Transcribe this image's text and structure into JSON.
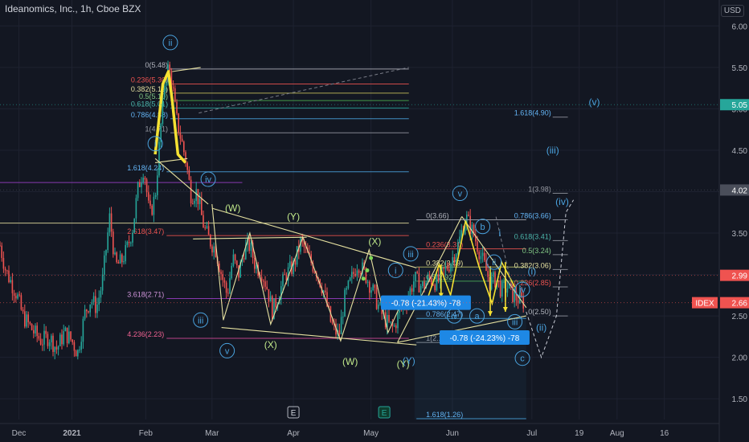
{
  "header": {
    "title": "Ideanomics, Inc., 1h, Cboe BZX",
    "currency": "USD"
  },
  "colors": {
    "bg": "#131722",
    "grid": "#1e2230",
    "up": "#26a69a",
    "down": "#ef5350",
    "wave": "#c0e88a",
    "fib": "#e6e1a0",
    "yellow": "#f5e133",
    "blue": "#4aa3df",
    "pink": "#d64a9a",
    "purple": "#9c3fc8",
    "olive": "#c8c25a"
  },
  "chart_data": {
    "type": "candlestick",
    "symbol": "IDEX",
    "interval": "1h",
    "ylim": [
      1.25,
      6.1
    ],
    "y_ticks": [
      1.5,
      2.0,
      2.5,
      3.0,
      3.5,
      4.0,
      4.5,
      5.0,
      5.5,
      6.0
    ],
    "y_tick_labels": [
      "1.50",
      "2.00",
      "2.50",
      "3.00",
      "3.50",
      "4.00",
      "4.50",
      "5.00",
      "5.50",
      "6.00"
    ],
    "x_ticks": [
      {
        "label": "Dec",
        "t": 0.0
      },
      {
        "label": "2021",
        "t": 2.8
      },
      {
        "label": "Feb",
        "t": 6.7
      },
      {
        "label": "Mar",
        "t": 10.2
      },
      {
        "label": "Apr",
        "t": 14.5
      },
      {
        "label": "May",
        "t": 18.6
      },
      {
        "label": "Jun",
        "t": 22.9
      },
      {
        "label": "Jul",
        "t": 27.1
      },
      {
        "label": "19",
        "t": 29.6
      },
      {
        "label": "Aug",
        "t": 31.6
      },
      {
        "label": "16",
        "t": 34.1
      }
    ],
    "xlim": [
      -1.0,
      37.0
    ],
    "price_path": [
      [
        -1.0,
        3.35
      ],
      [
        -0.7,
        3.05
      ],
      [
        -0.4,
        2.9
      ],
      [
        -0.1,
        2.75
      ],
      [
        0.2,
        2.5
      ],
      [
        0.5,
        2.4
      ],
      [
        0.8,
        2.3
      ],
      [
        1.2,
        2.2
      ],
      [
        1.6,
        2.25
      ],
      [
        2.0,
        2.1
      ],
      [
        2.4,
        2.3
      ],
      [
        2.8,
        2.2
      ],
      [
        3.1,
        2.05
      ],
      [
        3.5,
        2.55
      ],
      [
        3.8,
        2.7
      ],
      [
        4.1,
        2.6
      ],
      [
        4.4,
        2.9
      ],
      [
        4.6,
        3.3
      ],
      [
        4.8,
        3.7
      ],
      [
        5.1,
        3.1
      ],
      [
        5.4,
        3.15
      ],
      [
        5.7,
        3.3
      ],
      [
        6.0,
        3.55
      ],
      [
        6.3,
        4.05
      ],
      [
        6.6,
        4.3
      ],
      [
        6.9,
        3.7
      ],
      [
        7.2,
        3.95
      ],
      [
        7.5,
        4.8
      ],
      [
        7.7,
        5.35
      ],
      [
        7.9,
        5.5
      ],
      [
        8.1,
        5.3
      ],
      [
        8.3,
        4.9
      ],
      [
        8.5,
        4.7
      ],
      [
        8.8,
        4.4
      ],
      [
        9.1,
        3.95
      ],
      [
        9.4,
        4.0
      ],
      [
        9.6,
        3.75
      ],
      [
        9.8,
        3.55
      ],
      [
        10.1,
        3.4
      ],
      [
        10.4,
        3.3
      ],
      [
        10.7,
        3.0
      ],
      [
        11.0,
        2.75
      ],
      [
        11.3,
        3.2
      ],
      [
        11.6,
        3.0
      ],
      [
        11.9,
        3.3
      ],
      [
        12.2,
        3.35
      ],
      [
        12.5,
        3.1
      ],
      [
        12.8,
        3.05
      ],
      [
        13.1,
        2.85
      ],
      [
        13.4,
        2.55
      ],
      [
        13.7,
        2.75
      ],
      [
        14.1,
        3.0
      ],
      [
        14.5,
        3.1
      ],
      [
        14.9,
        3.4
      ],
      [
        15.3,
        3.2
      ],
      [
        15.7,
        3.05
      ],
      [
        16.1,
        2.8
      ],
      [
        16.5,
        2.4
      ],
      [
        16.9,
        2.25
      ],
      [
        17.2,
        2.7
      ],
      [
        17.5,
        2.9
      ],
      [
        17.9,
        3.15
      ],
      [
        18.3,
        3.0
      ],
      [
        18.7,
        2.8
      ],
      [
        19.1,
        2.55
      ],
      [
        19.5,
        2.4
      ],
      [
        19.8,
        2.35
      ],
      [
        20.1,
        2.55
      ],
      [
        20.5,
        2.7
      ],
      [
        20.9,
        2.95
      ],
      [
        21.3,
        2.85
      ],
      [
        21.7,
        2.95
      ],
      [
        22.1,
        2.9
      ],
      [
        22.5,
        3.05
      ],
      [
        22.8,
        3.15
      ],
      [
        23.2,
        3.35
      ],
      [
        23.6,
        3.7
      ],
      [
        24.0,
        3.5
      ],
      [
        24.3,
        3.3
      ],
      [
        24.6,
        3.1
      ],
      [
        24.9,
        2.9
      ],
      [
        25.2,
        2.95
      ],
      [
        25.5,
        2.8
      ],
      [
        25.8,
        2.85
      ],
      [
        26.1,
        2.75
      ],
      [
        26.4,
        2.7
      ],
      [
        26.7,
        2.66
      ]
    ],
    "price_axis_badges": [
      {
        "price": 5.05,
        "label": "5.05",
        "bg": "#26a69a",
        "color": "#ffffff"
      },
      {
        "price": 4.02,
        "label": "4.02",
        "bg": "#4a4e5a",
        "color": "#ffffff"
      },
      {
        "price": 2.99,
        "label": "2.99",
        "bg": "#ef5350",
        "color": "#ffffff"
      },
      {
        "price": 2.66,
        "label": "2.66",
        "bg": "#ef5350",
        "color": "#ffffff"
      }
    ],
    "symbol_badge": {
      "price": 2.66,
      "label": "IDEX"
    },
    "hlines": [
      {
        "price": 5.48,
        "x0": 8.0,
        "x1": 20.6,
        "color": "#b2b5be",
        "label": "0(5.48)",
        "lcolor": "#b2b5be"
      },
      {
        "price": 5.3,
        "x0": 8.0,
        "x1": 20.6,
        "color": "#ef5350",
        "label": "0.236(5.30)",
        "lcolor": "#ef5350"
      },
      {
        "price": 5.19,
        "x0": 8.0,
        "x1": 20.6,
        "color": "#c8c25a",
        "label": "0.382(5.19)",
        "lcolor": "#e6e1a0"
      },
      {
        "price": 5.1,
        "x0": 8.0,
        "x1": 20.6,
        "color": "#4caf50",
        "label": "0.5(5.10)",
        "lcolor": "#81c784"
      },
      {
        "price": 5.01,
        "x0": 8.0,
        "x1": 20.6,
        "color": "#26a69a",
        "label": "0.618(5.01)",
        "lcolor": "#4db6ac"
      },
      {
        "price": 4.88,
        "x0": 8.0,
        "x1": 20.6,
        "color": "#4aa3df",
        "label": "0.786(4.88)",
        "lcolor": "#64b5f6"
      },
      {
        "price": 4.71,
        "x0": 8.0,
        "x1": 20.6,
        "color": "#9598a1",
        "label": "1(4.71)",
        "lcolor": "#9598a1"
      },
      {
        "price": 4.24,
        "x0": 7.8,
        "x1": 20.6,
        "color": "#4aa3df",
        "label": "1.618(4.24)",
        "lcolor": "#64b5f6"
      },
      {
        "price": 4.11,
        "x0": -1.0,
        "x1": 11.8,
        "color": "#9c3fc8",
        "label": "",
        "lcolor": "#9c3fc8"
      },
      {
        "price": 3.62,
        "x0": -1.0,
        "x1": 20.6,
        "color": "#e6e1a0",
        "label": "",
        "lcolor": "#e6e1a0"
      },
      {
        "price": 3.47,
        "x0": 7.8,
        "x1": 20.6,
        "color": "#ef5350",
        "label": "2.618(3.47)",
        "lcolor": "#ef5350"
      },
      {
        "price": 2.71,
        "x0": 7.8,
        "x1": 20.6,
        "color": "#9c3fc8",
        "label": "3.618(2.71)",
        "lcolor": "#ce93d8"
      },
      {
        "price": 2.23,
        "x0": 7.8,
        "x1": 20.6,
        "color": "#d64a9a",
        "label": "4.236(2.23)",
        "lcolor": "#f06292"
      },
      {
        "price": 3.66,
        "x0": 21.0,
        "x1": 26.8,
        "color": "#b2b5be",
        "label": "0(3.66)",
        "lcolor": "#b2b5be"
      },
      {
        "price": 3.31,
        "x0": 21.0,
        "x1": 26.8,
        "color": "#ef5350",
        "label": "0.236(3.31)",
        "lcolor": "#ef5350"
      },
      {
        "price": 3.09,
        "x0": 21.0,
        "x1": 26.8,
        "color": "#c8c25a",
        "label": "0.382(3.09)",
        "lcolor": "#e6e1a0"
      },
      {
        "price": 2.92,
        "x0": 21.0,
        "x1": 26.8,
        "color": "#4caf50",
        "label": "0.5(2.92)",
        "lcolor": "#81c784"
      },
      {
        "price": 2.47,
        "x0": 21.0,
        "x1": 26.8,
        "color": "#4aa3df",
        "label": "0.786(2.47)",
        "lcolor": "#64b5f6"
      },
      {
        "price": 2.18,
        "x0": 21.0,
        "x1": 26.8,
        "color": "#9598a1",
        "label": "1(2.18)",
        "lcolor": "#9598a1"
      },
      {
        "price": 1.26,
        "x0": 21.0,
        "x1": 26.8,
        "color": "#4aa3df",
        "label": "1.618(1.26)",
        "lcolor": "#64b5f6"
      },
      {
        "price": 4.9,
        "x0": 28.2,
        "x1": 29.0,
        "color": "#9598a1",
        "label": "1.618(4.90)",
        "lcolor": "#64b5f6"
      },
      {
        "price": 3.98,
        "x0": 28.2,
        "x1": 29.0,
        "color": "#9598a1",
        "label": "1(3.98)",
        "lcolor": "#9598a1"
      },
      {
        "price": 3.66,
        "x0": 28.2,
        "x1": 29.0,
        "color": "#9598a1",
        "label": "0.786(3.66)",
        "lcolor": "#64b5f6"
      },
      {
        "price": 3.41,
        "x0": 28.2,
        "x1": 29.0,
        "color": "#9598a1",
        "label": "0.618(3.41)",
        "lcolor": "#4db6ac"
      },
      {
        "price": 3.24,
        "x0": 28.2,
        "x1": 29.0,
        "color": "#9598a1",
        "label": "0.5(3.24)",
        "lcolor": "#81c784"
      },
      {
        "price": 3.06,
        "x0": 28.2,
        "x1": 29.0,
        "color": "#9598a1",
        "label": "0.382(3.06)",
        "lcolor": "#e6e1a0"
      },
      {
        "price": 2.85,
        "x0": 28.2,
        "x1": 29.0,
        "color": "#9598a1",
        "label": "0.236(2.85)",
        "lcolor": "#ef5350"
      },
      {
        "price": 2.5,
        "x0": 28.2,
        "x1": 29.0,
        "color": "#9598a1",
        "label": "0(2.50)",
        "lcolor": "#b2b5be"
      }
    ],
    "trendlines": [
      {
        "pts": [
          [
            7.2,
            4.4
          ],
          [
            10.0,
            3.85
          ]
        ],
        "color": "#e6e1a0"
      },
      {
        "pts": [
          [
            7.2,
            4.35
          ],
          [
            8.9,
            4.4
          ]
        ],
        "color": "#e6e1a0"
      },
      {
        "pts": [
          [
            8.1,
            5.45
          ],
          [
            9.6,
            5.5
          ]
        ],
        "color": "#e6e1a0"
      },
      {
        "pts": [
          [
            9.2,
            3.43
          ],
          [
            15.2,
            3.45
          ]
        ],
        "color": "#e6e1a0"
      },
      {
        "pts": [
          [
            10.2,
            3.8
          ],
          [
            21.0,
            3.08
          ]
        ],
        "color": "#e6e1a0"
      },
      {
        "pts": [
          [
            10.7,
            2.36
          ],
          [
            21.0,
            2.15
          ]
        ],
        "color": "#e6e1a0"
      },
      {
        "pts": [
          [
            10.2,
            3.85
          ],
          [
            10.8,
            2.45
          ],
          [
            12.2,
            3.5
          ],
          [
            13.3,
            2.4
          ],
          [
            15.0,
            3.45
          ],
          [
            17.0,
            2.2
          ],
          [
            18.5,
            3.3
          ],
          [
            19.5,
            2.3
          ],
          [
            20.2,
            2.65
          ]
        ],
        "color": "#e6e1a0"
      },
      {
        "pts": [
          [
            20.0,
            2.18
          ],
          [
            23.4,
            3.7
          ]
        ],
        "color": "#e6e1a0"
      },
      {
        "pts": [
          [
            20.0,
            2.18
          ],
          [
            26.8,
            2.5
          ]
        ],
        "color": "#e6e1a0"
      },
      {
        "pts": [
          [
            23.4,
            3.7
          ],
          [
            26.8,
            2.6
          ]
        ],
        "color": "#e6e1a0"
      },
      {
        "pts": [
          [
            23.4,
            3.66
          ],
          [
            26.8,
            3.66
          ]
        ],
        "color": "#9598a1"
      },
      {
        "pts": [
          [
            21.6,
            2.72
          ],
          [
            22.2,
            3.12
          ],
          [
            22.8,
            2.75
          ],
          [
            23.6,
            3.65
          ],
          [
            24.3,
            3.1
          ],
          [
            25.0,
            2.65
          ],
          [
            25.5,
            3.15
          ],
          [
            26.2,
            2.85
          ]
        ],
        "color": "#f5e133"
      }
    ],
    "dashed_lines": [
      {
        "pts": [
          [
            9.5,
            4.95
          ],
          [
            20.6,
            5.5
          ]
        ],
        "color": "#787b86"
      },
      {
        "pts": [
          [
            26.8,
            2.55
          ],
          [
            27.6,
            2.0
          ],
          [
            28.4,
            2.5
          ],
          [
            28.9,
            3.75
          ],
          [
            29.3,
            3.9
          ]
        ],
        "color": "#c9ccd6"
      },
      {
        "pts": [
          [
            26.1,
            2.8
          ],
          [
            25.2,
            3.7
          ]
        ],
        "color": "#787b86"
      }
    ],
    "yellow_m": [
      [
        7.2,
        4.45
      ],
      [
        7.6,
        5.3
      ],
      [
        7.9,
        5.45
      ],
      [
        8.1,
        5.1
      ],
      [
        8.4,
        4.45
      ],
      [
        8.8,
        4.35
      ]
    ],
    "arrows": [
      {
        "x": 22.3,
        "from": 3.12,
        "to": 2.72
      },
      {
        "x": 24.9,
        "from": 3.1,
        "to": 2.5
      },
      {
        "x": 25.7,
        "from": 3.15,
        "to": 2.55
      }
    ],
    "wave_labels": [
      {
        "t": 8.0,
        "price": 5.8,
        "text": "ii",
        "circle": true,
        "color": "#4aa3df"
      },
      {
        "t": 7.2,
        "price": 4.58,
        "text": "i",
        "circle": true,
        "color": "#4aa3df"
      },
      {
        "t": 10.0,
        "price": 4.15,
        "text": "iv",
        "circle": true,
        "color": "#4aa3df"
      },
      {
        "t": 9.6,
        "price": 2.45,
        "text": "iii",
        "circle": true,
        "color": "#4aa3df"
      },
      {
        "t": 11.0,
        "price": 2.08,
        "text": "v",
        "circle": true,
        "color": "#4aa3df"
      },
      {
        "t": 11.3,
        "price": 3.8,
        "text": "(W)",
        "circle": false,
        "color": "#c0e88a"
      },
      {
        "t": 14.5,
        "price": 3.7,
        "text": "(Y)",
        "circle": false,
        "color": "#c0e88a"
      },
      {
        "t": 13.3,
        "price": 2.15,
        "text": "(X)",
        "circle": false,
        "color": "#c0e88a"
      },
      {
        "t": 18.8,
        "price": 3.4,
        "text": "(X)",
        "circle": false,
        "color": "#c0e88a"
      },
      {
        "t": 17.5,
        "price": 1.95,
        "text": "(W)",
        "circle": false,
        "color": "#c0e88a"
      },
      {
        "t": 20.3,
        "price": 1.92,
        "text": "(Y)",
        "circle": false,
        "color": "#c0e88a"
      },
      {
        "t": 20.6,
        "price": 1.96,
        "text": "(Y)",
        "circle": false,
        "color": "#4aa3df"
      },
      {
        "t": 19.9,
        "price": 3.05,
        "text": "i",
        "circle": true,
        "color": "#4aa3df"
      },
      {
        "t": 20.7,
        "price": 3.25,
        "text": "iii",
        "circle": true,
        "color": "#4aa3df"
      },
      {
        "t": 23.3,
        "price": 3.98,
        "text": "v",
        "circle": true,
        "color": "#4aa3df"
      },
      {
        "t": 23.0,
        "price": 2.5,
        "text": "iv",
        "circle": true,
        "color": "#4aa3df"
      },
      {
        "t": 24.5,
        "price": 3.58,
        "text": "b",
        "circle": true,
        "color": "#4aa3df"
      },
      {
        "t": 24.2,
        "price": 2.5,
        "text": "a",
        "circle": true,
        "color": "#4aa3df"
      },
      {
        "t": 25.1,
        "price": 3.15,
        "text": "ii",
        "circle": true,
        "color": "#4aa3df"
      },
      {
        "t": 25.4,
        "price": 3.5,
        "text": "i",
        "circle": false,
        "color": "#4aa3df"
      },
      {
        "t": 26.6,
        "price": 2.82,
        "text": "iv",
        "circle": true,
        "color": "#4aa3df"
      },
      {
        "t": 26.2,
        "price": 2.43,
        "text": "iii",
        "circle": true,
        "color": "#4aa3df"
      },
      {
        "t": 27.1,
        "price": 3.04,
        "text": "(i)",
        "circle": false,
        "color": "#4aa3df"
      },
      {
        "t": 27.6,
        "price": 2.36,
        "text": "(ii)",
        "circle": false,
        "color": "#4aa3df"
      },
      {
        "t": 28.2,
        "price": 4.5,
        "text": "(iii)",
        "circle": false,
        "color": "#4aa3df"
      },
      {
        "t": 28.7,
        "price": 3.88,
        "text": "(iv)",
        "circle": false,
        "color": "#4aa3df"
      },
      {
        "t": 30.4,
        "price": 5.08,
        "text": "(v)",
        "circle": false,
        "color": "#4aa3df"
      },
      {
        "t": 26.6,
        "price": 1.99,
        "text": "c",
        "circle": true,
        "color": "#4aa3df"
      }
    ],
    "measure_boxes": [
      {
        "t": 21.5,
        "price": 2.66,
        "text": "-0.78 (-21.43%) -78"
      },
      {
        "t": 24.6,
        "price": 2.24,
        "text": "-0.78 (-24.23%) -78"
      }
    ],
    "event_markers": [
      {
        "t": 14.5,
        "text": "E",
        "style": "outline"
      },
      {
        "t": 19.3,
        "text": "E",
        "style": "green"
      }
    ]
  }
}
